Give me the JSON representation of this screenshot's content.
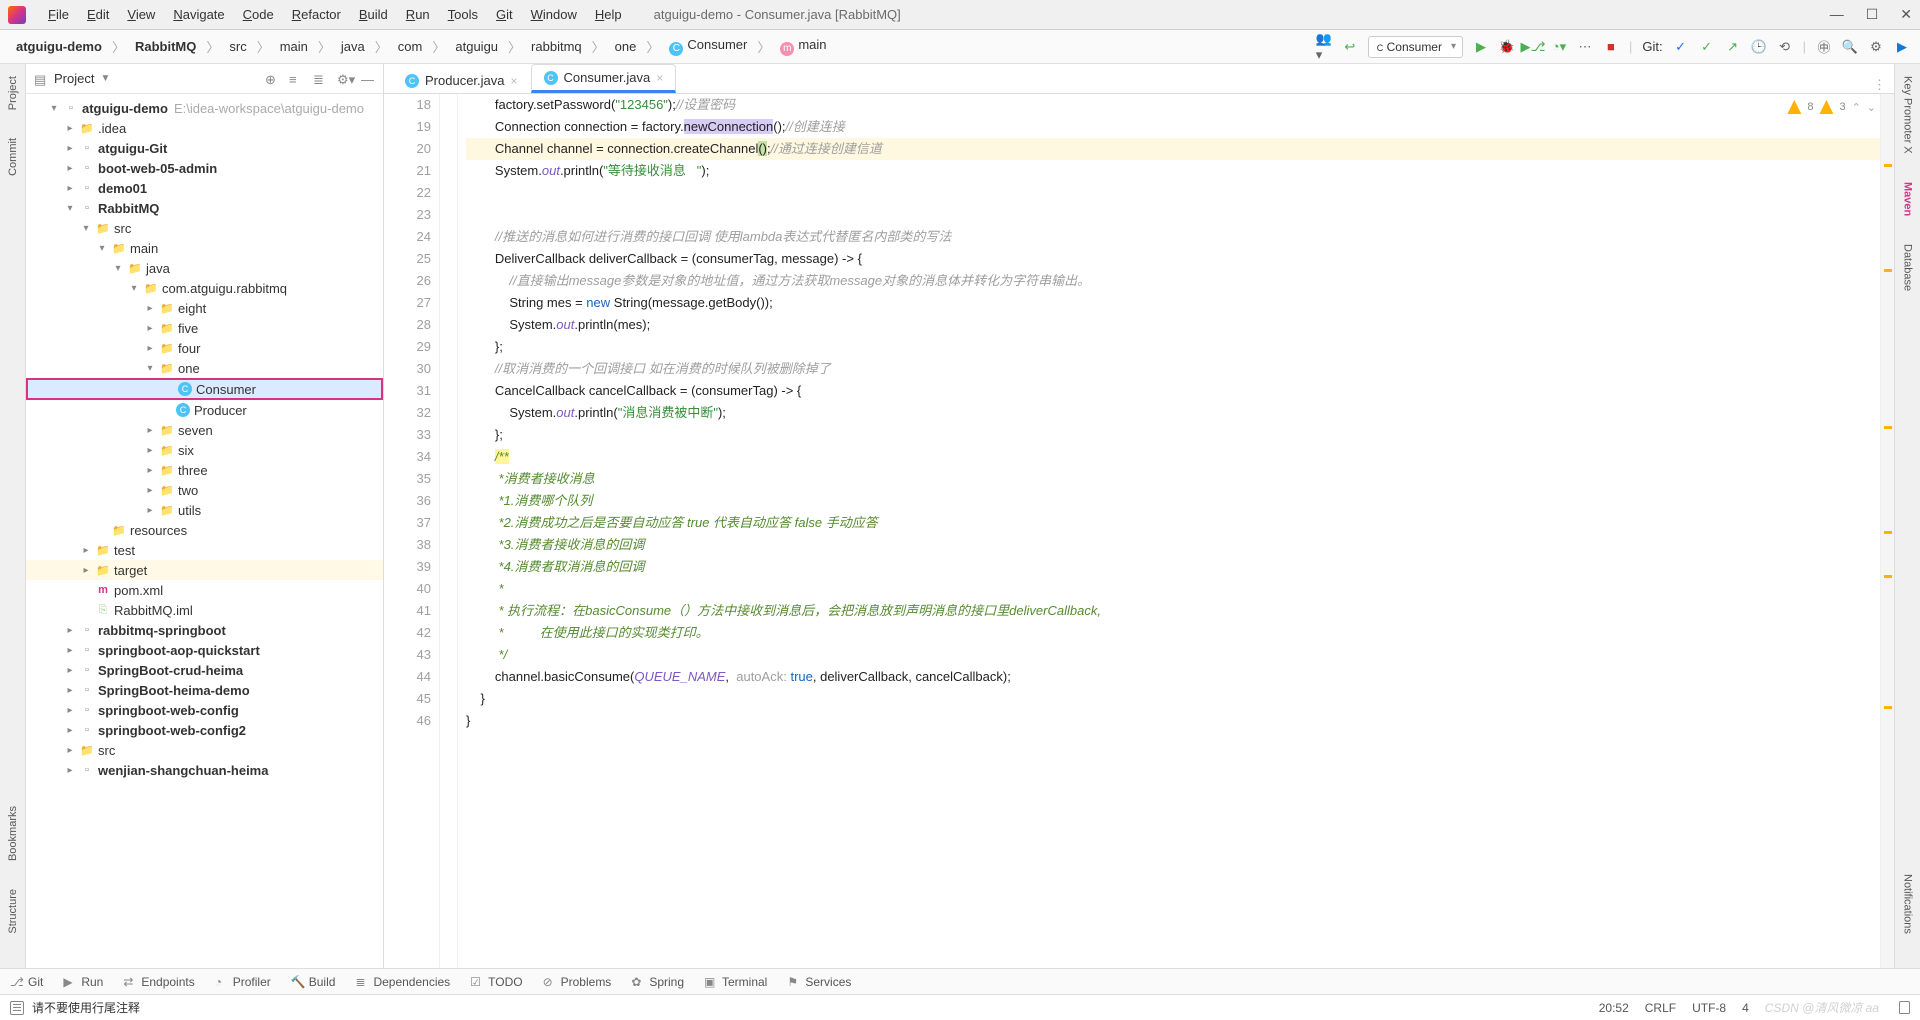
{
  "title": "atguigu-demo - Consumer.java [RabbitMQ]",
  "menu": [
    "File",
    "Edit",
    "View",
    "Navigate",
    "Code",
    "Refactor",
    "Build",
    "Run",
    "Tools",
    "Git",
    "Window",
    "Help"
  ],
  "breadcrumbs": [
    "atguigu-demo",
    "RabbitMQ",
    "src",
    "main",
    "java",
    "com",
    "atguigu",
    "rabbitmq",
    "one",
    "Consumer",
    "main"
  ],
  "run_config": "Consumer",
  "git_label": "Git:",
  "project_header": "Project",
  "tree": {
    "root": "atguigu-demo",
    "root_path": "E:\\idea-workspace\\atguigu-demo",
    "items": [
      {
        "depth": 1,
        "arrow": "▾",
        "ico": "mod",
        "label": "atguigu-demo",
        "hint": "E:\\idea-workspace\\atguigu-demo",
        "bold": true
      },
      {
        "depth": 2,
        "arrow": "▸",
        "ico": "folder",
        "label": ".idea"
      },
      {
        "depth": 2,
        "arrow": "▸",
        "ico": "mod",
        "label": "atguigu-Git",
        "bold": true
      },
      {
        "depth": 2,
        "arrow": "▸",
        "ico": "mod",
        "label": "boot-web-05-admin",
        "bold": true
      },
      {
        "depth": 2,
        "arrow": "▸",
        "ico": "mod",
        "label": "demo01",
        "bold": true
      },
      {
        "depth": 2,
        "arrow": "▾",
        "ico": "mod",
        "label": "RabbitMQ",
        "bold": true
      },
      {
        "depth": 3,
        "arrow": "▾",
        "ico": "folder-blue",
        "label": "src"
      },
      {
        "depth": 4,
        "arrow": "▾",
        "ico": "folder-blue",
        "label": "main"
      },
      {
        "depth": 5,
        "arrow": "▾",
        "ico": "folder-blue",
        "label": "java"
      },
      {
        "depth": 6,
        "arrow": "▾",
        "ico": "folder",
        "label": "com.atguigu.rabbitmq"
      },
      {
        "depth": 7,
        "arrow": "▸",
        "ico": "folder",
        "label": "eight"
      },
      {
        "depth": 7,
        "arrow": "▸",
        "ico": "folder",
        "label": "five"
      },
      {
        "depth": 7,
        "arrow": "▸",
        "ico": "folder",
        "label": "four"
      },
      {
        "depth": 7,
        "arrow": "▾",
        "ico": "folder",
        "label": "one"
      },
      {
        "depth": 8,
        "arrow": "",
        "ico": "cls",
        "label": "Consumer",
        "selected": true
      },
      {
        "depth": 8,
        "arrow": "",
        "ico": "cls",
        "label": "Producer"
      },
      {
        "depth": 7,
        "arrow": "▸",
        "ico": "folder",
        "label": "seven"
      },
      {
        "depth": 7,
        "arrow": "▸",
        "ico": "folder",
        "label": "six"
      },
      {
        "depth": 7,
        "arrow": "▸",
        "ico": "folder",
        "label": "three"
      },
      {
        "depth": 7,
        "arrow": "▸",
        "ico": "folder",
        "label": "two"
      },
      {
        "depth": 7,
        "arrow": "▸",
        "ico": "folder",
        "label": "utils"
      },
      {
        "depth": 4,
        "arrow": "",
        "ico": "folder",
        "label": "resources"
      },
      {
        "depth": 3,
        "arrow": "▸",
        "ico": "folder",
        "label": "test"
      },
      {
        "depth": 3,
        "arrow": "▸",
        "ico": "folder-orange",
        "label": "target",
        "target": true
      },
      {
        "depth": 3,
        "arrow": "",
        "ico": "m",
        "label": "pom.xml"
      },
      {
        "depth": 3,
        "arrow": "",
        "ico": "iml",
        "label": "RabbitMQ.iml"
      },
      {
        "depth": 2,
        "arrow": "▸",
        "ico": "mod",
        "label": "rabbitmq-springboot",
        "bold": true
      },
      {
        "depth": 2,
        "arrow": "▸",
        "ico": "mod",
        "label": "springboot-aop-quickstart",
        "bold": true
      },
      {
        "depth": 2,
        "arrow": "▸",
        "ico": "mod",
        "label": "SpringBoot-crud-heima",
        "bold": true
      },
      {
        "depth": 2,
        "arrow": "▸",
        "ico": "mod",
        "label": "SpringBoot-heima-demo",
        "bold": true
      },
      {
        "depth": 2,
        "arrow": "▸",
        "ico": "mod",
        "label": "springboot-web-config",
        "bold": true
      },
      {
        "depth": 2,
        "arrow": "▸",
        "ico": "mod",
        "label": "springboot-web-config2",
        "bold": true
      },
      {
        "depth": 2,
        "arrow": "▸",
        "ico": "folder",
        "label": "src"
      },
      {
        "depth": 2,
        "arrow": "▸",
        "ico": "mod",
        "label": "wenjian-shangchuan-heima",
        "bold": true
      }
    ]
  },
  "tabs": [
    {
      "label": "Producer.java",
      "active": false
    },
    {
      "label": "Consumer.java",
      "active": true
    }
  ],
  "inspections": {
    "warn1": "8",
    "warn2": "3"
  },
  "editor": {
    "first_line": 18,
    "lines": [
      {
        "n": 18,
        "seg": [
          {
            "t": "        factory.setPassword("
          },
          {
            "t": "\"123456\"",
            "c": "str"
          },
          {
            "t": ");"
          },
          {
            "t": "//设置密码",
            "c": "cmt"
          }
        ]
      },
      {
        "n": 19,
        "seg": [
          {
            "t": "        Connection connection = factory."
          },
          {
            "t": "newConnection",
            "c": "hl-method"
          },
          {
            "t": "();"
          },
          {
            "t": "//创建连接",
            "c": "cmt"
          }
        ]
      },
      {
        "n": 20,
        "hl": true,
        "seg": [
          {
            "t": "        Channel channel = connection.createChannel"
          },
          {
            "t": "()",
            "c": "hl-paren"
          },
          {
            "t": ";"
          },
          {
            "t": "//通过连接创建信道",
            "c": "cmt"
          }
        ]
      },
      {
        "n": 21,
        "seg": [
          {
            "t": "        System."
          },
          {
            "t": "out",
            "c": "static"
          },
          {
            "t": ".println("
          },
          {
            "t": "\"等待接收消息   \"",
            "c": "str"
          },
          {
            "t": ");"
          }
        ]
      },
      {
        "n": 22,
        "seg": [
          {
            "t": ""
          }
        ]
      },
      {
        "n": 23,
        "seg": [
          {
            "t": ""
          }
        ]
      },
      {
        "n": 24,
        "seg": [
          {
            "t": "        "
          },
          {
            "t": "//推送的消息如何进行消费的接口回调 使用lambda表达式代替匿名内部类的写法",
            "c": "cmt"
          }
        ]
      },
      {
        "n": 25,
        "seg": [
          {
            "t": "        DeliverCallback deliverCallback = (consumerTag, message) -> {"
          }
        ]
      },
      {
        "n": 26,
        "seg": [
          {
            "t": "            "
          },
          {
            "t": "//直接输出message参数是对象的地址值，通过方法获取message对象的消息体并转化为字符串输出。",
            "c": "cmt"
          }
        ]
      },
      {
        "n": 27,
        "seg": [
          {
            "t": "            String mes = "
          },
          {
            "t": "new",
            "c": "kw"
          },
          {
            "t": " String(message.getBody());"
          }
        ]
      },
      {
        "n": 28,
        "seg": [
          {
            "t": "            System."
          },
          {
            "t": "out",
            "c": "static"
          },
          {
            "t": ".println(mes);"
          }
        ]
      },
      {
        "n": 29,
        "seg": [
          {
            "t": "        };"
          }
        ]
      },
      {
        "n": 30,
        "seg": [
          {
            "t": "        "
          },
          {
            "t": "//取消消费的一个回调接口 如在消费的时候队列被删除掉了",
            "c": "cmt"
          }
        ]
      },
      {
        "n": 31,
        "seg": [
          {
            "t": "        CancelCallback cancelCallback = (consumerTag) -> {"
          }
        ]
      },
      {
        "n": 32,
        "seg": [
          {
            "t": "            System."
          },
          {
            "t": "out",
            "c": "static"
          },
          {
            "t": ".println("
          },
          {
            "t": "\"消息消费被中断\"",
            "c": "str"
          },
          {
            "t": ");"
          }
        ]
      },
      {
        "n": 33,
        "seg": [
          {
            "t": "        };"
          }
        ]
      },
      {
        "n": 34,
        "seg": [
          {
            "t": "        "
          },
          {
            "t": "/**",
            "c": "doc hl-yellow"
          }
        ]
      },
      {
        "n": 35,
        "seg": [
          {
            "t": "         *消费者接收消息",
            "c": "doc"
          }
        ]
      },
      {
        "n": 36,
        "seg": [
          {
            "t": "         *1.消费哪个队列",
            "c": "doc"
          }
        ]
      },
      {
        "n": 37,
        "seg": [
          {
            "t": "         *2.消费成功之后是否要自动应答 true 代表自动应答 false 手动应答",
            "c": "doc"
          }
        ]
      },
      {
        "n": 38,
        "seg": [
          {
            "t": "         *3.消费者接收消息的回调",
            "c": "doc"
          }
        ]
      },
      {
        "n": 39,
        "seg": [
          {
            "t": "         *4.消费者取消消息的回调",
            "c": "doc"
          }
        ]
      },
      {
        "n": 40,
        "seg": [
          {
            "t": "         *",
            "c": "doc"
          }
        ]
      },
      {
        "n": 41,
        "seg": [
          {
            "t": "         * 执行流程：在basicConsume（）方法中接收到消息后，会把消息放到声明消息的接口里deliverCallback,",
            "c": "doc"
          }
        ]
      },
      {
        "n": 42,
        "seg": [
          {
            "t": "         *          在使用此接口的实现类打印。",
            "c": "doc"
          }
        ]
      },
      {
        "n": 43,
        "seg": [
          {
            "t": "         */",
            "c": "doc"
          }
        ]
      },
      {
        "n": 44,
        "seg": [
          {
            "t": "        channel.basicConsume("
          },
          {
            "t": "QUEUE_NAME",
            "c": "const"
          },
          {
            "t": ",  "
          },
          {
            "t": "autoAck:",
            "c": "hint"
          },
          {
            "t": " "
          },
          {
            "t": "true",
            "c": "kw"
          },
          {
            "t": ", deliverCallback, cancelCallback);"
          }
        ]
      },
      {
        "n": 45,
        "seg": [
          {
            "t": "    }"
          }
        ]
      },
      {
        "n": 46,
        "seg": [
          {
            "t": "}"
          }
        ]
      }
    ]
  },
  "left_rail": [
    "Project",
    "Commit",
    "Bookmarks",
    "Structure"
  ],
  "right_rail": [
    "Key Promoter X",
    "Maven",
    "Database",
    "Notifications"
  ],
  "bottom_tools": [
    "Git",
    "Run",
    "Endpoints",
    "Profiler",
    "Build",
    "Dependencies",
    "TODO",
    "Problems",
    "Spring",
    "Terminal",
    "Services"
  ],
  "status_msg": "请不要使用行尾注释",
  "status_right": {
    "time": "20:52",
    "eol": "CRLF",
    "enc": "UTF-8",
    "indent": "4",
    "watermark": "CSDN @清风微凉 aa"
  }
}
